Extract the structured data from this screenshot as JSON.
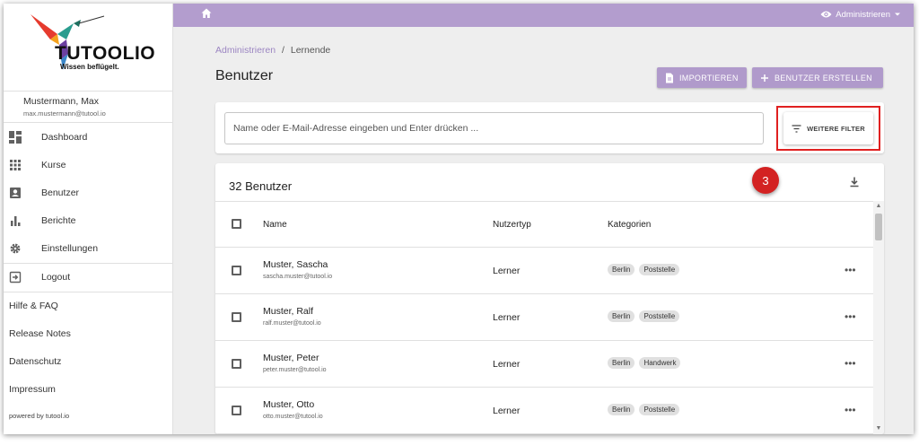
{
  "logo": {
    "name": "TUTOOLIO",
    "tagline": "Wissen beflügelt."
  },
  "user": {
    "name": "Mustermann, Max",
    "email": "max.mustermann@tutool.io"
  },
  "nav": [
    {
      "label": "Dashboard",
      "icon": "dashboard-icon"
    },
    {
      "label": "Kurse",
      "icon": "grid-icon"
    },
    {
      "label": "Benutzer",
      "icon": "user-card-icon"
    },
    {
      "label": "Berichte",
      "icon": "bar-chart-icon"
    },
    {
      "label": "Einstellungen",
      "icon": "gear-icon"
    },
    {
      "label": "Logout",
      "icon": "logout-icon"
    }
  ],
  "links": [
    "Hilfe & FAQ",
    "Release Notes",
    "Datenschutz",
    "Impressum"
  ],
  "powered_by": "powered by tutool.io",
  "topbar": {
    "admin_label": "Administrieren",
    "accent": "#b39dce"
  },
  "breadcrumb": {
    "parent": "Administrieren",
    "separator": "/",
    "current": "Lernende"
  },
  "page_title": "Benutzer",
  "buttons": {
    "import": "IMPORTIEREN",
    "create": "BENUTZER ERSTELLEN",
    "more_filter": "WEITERE FILTER"
  },
  "search": {
    "placeholder": "Name oder E-Mail-Adresse eingeben und Enter drücken ..."
  },
  "table": {
    "count_label": "32 Benutzer",
    "step_badge": "3",
    "headers": {
      "name": "Name",
      "type": "Nutzertyp",
      "categories": "Kategorien"
    },
    "rows": [
      {
        "name": "Muster, Sascha",
        "email": "sascha.muster@tutool.io",
        "type": "Lerner",
        "categories": [
          "Berlin",
          "Poststelle"
        ]
      },
      {
        "name": "Muster, Ralf",
        "email": "ralf.muster@tutool.io",
        "type": "Lerner",
        "categories": [
          "Berlin",
          "Poststelle"
        ]
      },
      {
        "name": "Muster, Peter",
        "email": "peter.muster@tutool.io",
        "type": "Lerner",
        "categories": [
          "Berlin",
          "Handwerk"
        ]
      },
      {
        "name": "Muster, Otto",
        "email": "otto.muster@tutool.io",
        "type": "Lerner",
        "categories": [
          "Berlin",
          "Poststelle"
        ]
      }
    ]
  }
}
